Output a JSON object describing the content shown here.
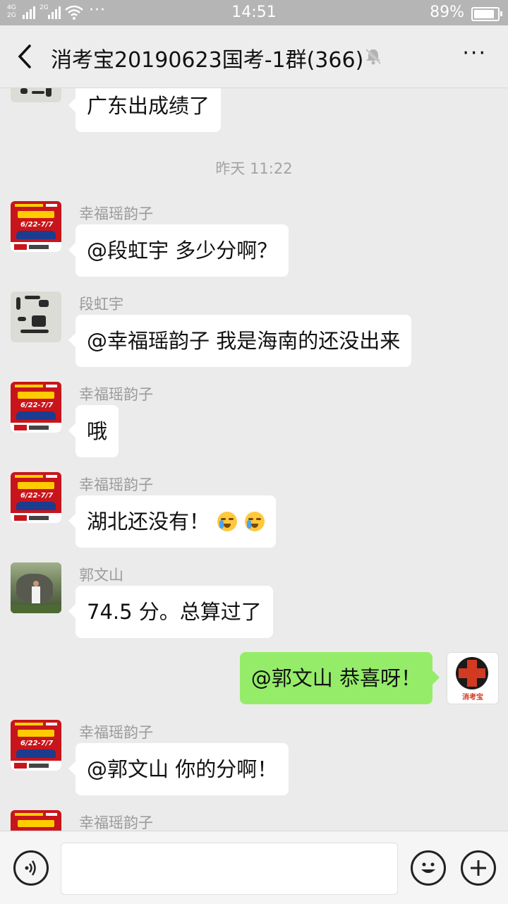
{
  "status_bar": {
    "time": "14:51",
    "battery": "89%",
    "net1": "4G\n2G",
    "net2": "2G",
    "more": "···"
  },
  "nav": {
    "title": "消考宝20190623国考-1群(366)",
    "more": "···"
  },
  "messages": [
    {
      "type": "text",
      "sender": "",
      "text": "广东出成绩了"
    },
    {
      "type": "time",
      "text": "昨天 11:22"
    },
    {
      "type": "text",
      "sender": "幸福瑶韵子",
      "text": "@段虹宇  多少分啊？"
    },
    {
      "type": "text",
      "sender": "段虹宇",
      "text": "@幸福瑶韵子  我是海南的还没出来"
    },
    {
      "type": "text",
      "sender": "幸福瑶韵子",
      "text": "哦"
    },
    {
      "type": "text",
      "sender": "幸福瑶韵子",
      "text": "湖北还没有！"
    },
    {
      "type": "text",
      "sender": "郭文山",
      "text": "74.5 分。总算过了"
    },
    {
      "type": "text",
      "sender": "me",
      "text": "@郭文山 恭喜呀！"
    },
    {
      "type": "text",
      "sender": "幸福瑶韵子",
      "text": "@郭文山  你的分啊！"
    },
    {
      "type": "text",
      "sender": "幸福瑶韵子",
      "text": ""
    }
  ],
  "avatars": {
    "promo_date": "6/22-7/7",
    "fire_label": "消考宝"
  },
  "input": {
    "placeholder": ""
  }
}
